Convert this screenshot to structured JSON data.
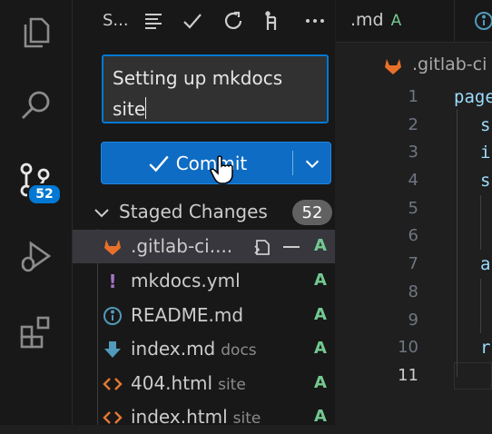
{
  "activity_bar": {
    "items": [
      "explorer",
      "search",
      "source-control",
      "run-and-debug",
      "extensions"
    ],
    "scm_badge": "52"
  },
  "sidebar": {
    "title": "S...",
    "commit_message": "Setting up mkdocs site",
    "commit_label": "Commit",
    "staged_label": "Staged Changes",
    "staged_count": "52",
    "files": [
      {
        "name": ".gitlab-ci....",
        "dir": "",
        "status": "A",
        "icon": "gitlab-icon"
      },
      {
        "name": "mkdocs.yml",
        "dir": "",
        "status": "A",
        "icon": "yaml-exclamation-icon"
      },
      {
        "name": "README.md",
        "dir": "",
        "status": "A",
        "icon": "info-icon"
      },
      {
        "name": "index.md",
        "dir": "docs",
        "status": "A",
        "icon": "markdown-arrow-icon"
      },
      {
        "name": "404.html",
        "dir": "site",
        "status": "A",
        "icon": "html-code-icon"
      },
      {
        "name": "index.html",
        "dir": "site",
        "status": "A",
        "icon": "html-code-icon"
      }
    ]
  },
  "editor": {
    "tab_label": ".md",
    "tab_status": "A",
    "breadcrumb": ".gitlab-ci",
    "line_numbers": [
      "1",
      "2",
      "3",
      "4",
      "5",
      "6",
      "7",
      "8",
      "9",
      "10",
      "11"
    ],
    "code_lines": [
      "page",
      "s",
      "i",
      "s",
      "",
      "",
      "a",
      "",
      "",
      "r",
      ""
    ]
  },
  "colors": {
    "accent": "#0078d4",
    "added": "#73c991",
    "gitlab": "#e8702a",
    "yaml": "#a074c4",
    "markdown": "#519aba",
    "html": "#e37933"
  }
}
